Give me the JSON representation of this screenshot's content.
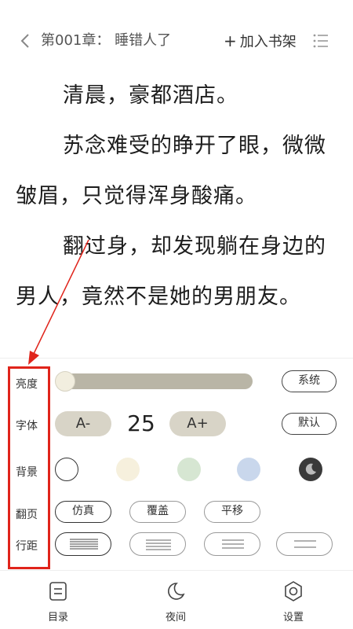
{
  "header": {
    "chapter_title": "第001章： 睡错人了",
    "add_shelf_plus": "+",
    "add_shelf_label": "加入书架"
  },
  "content": {
    "paragraphs": [
      "清晨，豪都酒店。",
      "苏念难受的睁开了眼，微微皱眉，只觉得浑身酸痛。",
      "翻过身，却发现躺在身边的男人，竟然不是她的男朋友。"
    ]
  },
  "settings": {
    "labels": {
      "brightness": "亮度",
      "font": "字体",
      "background": "背景",
      "page_turn": "翻页",
      "line_spacing": "行距"
    },
    "brightness_level": 0.0,
    "system_label": "系统",
    "font_minus": "A-",
    "font_size": "25",
    "font_plus": "A+",
    "default_label": "默认",
    "backgrounds": [
      "#ffffff",
      "#f6f0dd",
      "#d6e6d2",
      "#c9d7ec",
      "#3a3a3a"
    ],
    "page_turn_options": [
      "仿真",
      "覆盖",
      "平移"
    ],
    "line_spacing_options": 4,
    "annotation_color": "#e0241b"
  },
  "bottom_nav": {
    "toc": "目录",
    "night": "夜间",
    "settings": "设置"
  }
}
